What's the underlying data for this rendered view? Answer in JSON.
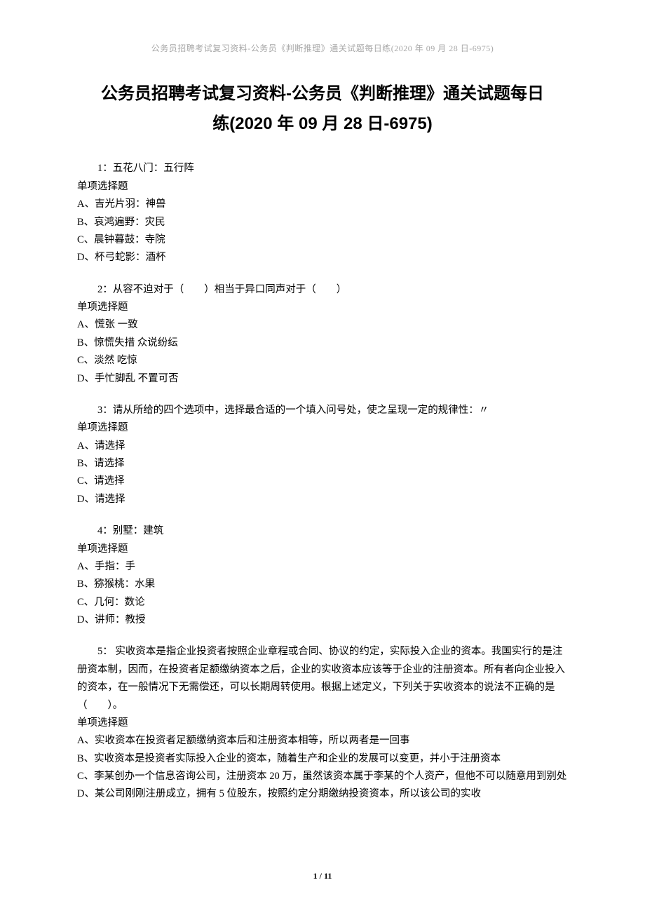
{
  "header": "公务员招聘考试复习资料-公务员《判断推理》通关试题每日练(2020 年 09 月 28 日-6975)",
  "title_line1": "公务员招聘考试复习资料-公务员《判断推理》通关试题每日",
  "title_line2": "练(2020 年 09 月 28 日-6975)",
  "questions": [
    {
      "number": "1：",
      "text": "五花八门：五行阵",
      "type": "单项选择题",
      "options": [
        "A、吉光片羽：神兽",
        "B、哀鸿遍野：灾民",
        "C、晨钟暮鼓：寺院",
        "D、杯弓蛇影：酒杯"
      ]
    },
    {
      "number": "2：",
      "text": "从容不迫对于（　　）相当于异口同声对于（　　）",
      "type": "单项选择题",
      "options": [
        "A、慌张 一致",
        "B、惊慌失措 众说纷纭",
        "C、淡然 吃惊",
        "D、手忙脚乱 不置可否"
      ]
    },
    {
      "number": "3：",
      "text": "请从所给的四个选项中，选择最合适的一个填入问号处，使之呈现一定的规律性：〃",
      "type": "单项选择题",
      "options": [
        "A、请选择",
        "B、请选择",
        "C、请选择",
        "D、请选择"
      ]
    },
    {
      "number": "4：",
      "text": "别墅：建筑",
      "type": "单项选择题",
      "options": [
        "A、手指：手",
        "B、猕猴桃：水果",
        "C、几何：数论",
        "D、讲师：教授"
      ]
    },
    {
      "number": "5：",
      "text": " 实收资本是指企业投资者按照企业章程或合同、协议的约定，实际投入企业的资本。我国实行的是注册资本制，因而，在投资者足额缴纳资本之后，企业的实收资本应该等于企业的注册资本。所有者向企业投入的资本，在一般情况下无需偿还，可以长期周转使用。根据上述定义，下列关于实收资本的说法不正确的是（　　）。",
      "type": "单项选择题",
      "options": [
        "A、实收资本在投资者足额缴纳资本后和注册资本相等，所以两者是一回事",
        "B、实收资本是投资者实际投入企业的资本，随着生产和企业的发展可以变更，并小于注册资本",
        "C、李某创办一个信息咨询公司，注册资本 20 万，虽然该资本属于李某的个人资产，但他不可以随意用到别处",
        "D、某公司刚刚注册成立，拥有 5 位股东，按照约定分期缴纳投资资本，所以该公司的实收"
      ]
    }
  ],
  "footer": "1 / 11"
}
